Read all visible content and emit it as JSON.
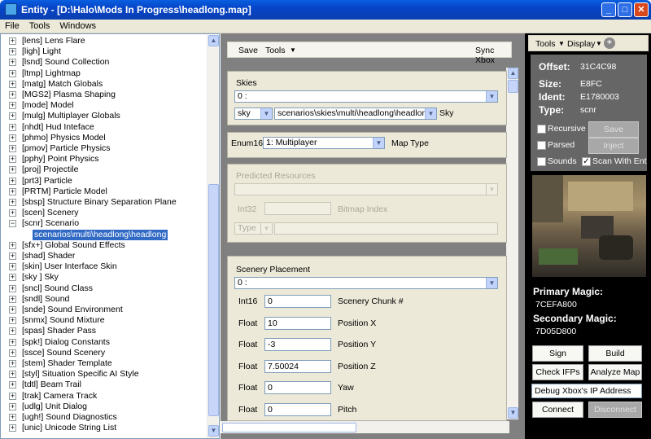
{
  "window": {
    "title": "Entity - [D:\\Halo\\Mods In Progress\\headlong.map]",
    "min": "_",
    "max": "□",
    "close": "✕"
  },
  "menu": [
    "File",
    "Tools",
    "Windows"
  ],
  "tree": [
    "[lens] Lens Flare",
    "[ligh] Light",
    "[lsnd] Sound Collection",
    "[ltmp] Lightmap",
    "[matg] Match Globals",
    "[MGS2] Plasma Shaping",
    "[mode] Model",
    "[mulg] Multiplayer Globals",
    "[nhdt] Hud Inteface",
    "[phmo] Physics Model",
    "[pmov] Particle Physics",
    "[pphy] Point Physics",
    "[proj] Projectile",
    "[prt3] Particle",
    "[PRTM] Particle Model",
    "[sbsp] Structure Binary Separation Plane",
    "[scen] Scenery",
    "[scnr] Scenario",
    "[sfx+] Global Sound Effects",
    "[shad] Shader",
    "[skin] User Interface Skin",
    "[sky ] Sky",
    "[sncl] Sound Class",
    "[sndl] Sound",
    "[snde] Sound Environment",
    "[snmx] Sound Mixture",
    "[spas] Shader Pass",
    "[spk!] Dialog Constants",
    "[ssce] Sound Scenery",
    "[stem] Shader Template",
    "[styl] Situation Specific AI Style",
    "[tdtl] Beam Trail",
    "[trak] Camera Track",
    "[udlg] Unit Dialog",
    "[ugh!] Sound Diagnostics",
    "[unic] Unicode String List"
  ],
  "tree_child": "scenarios\\multi\\headlong\\headlong",
  "center_toolbar": {
    "save": "Save",
    "tools": "Tools",
    "sync": "Sync Xbox"
  },
  "skies": {
    "title": "Skies",
    "index": "0 :",
    "type": "sky",
    "path": "scenarios\\skies\\multi\\headlong\\headlong",
    "label": "Sky"
  },
  "enum": {
    "type": "Enum16",
    "value": "1: Multiplayer",
    "label": "Map Type"
  },
  "predicted": {
    "title": "Predicted Resources",
    "type": "Int32",
    "label": "Bitmap Index",
    "combo": "Type"
  },
  "scenery": {
    "title": "Scenery Placement",
    "index": "0 :",
    "fields": [
      {
        "type": "Int16",
        "value": "0",
        "label": "Scenery Chunk #"
      },
      {
        "type": "Float",
        "value": "10",
        "label": "Position X"
      },
      {
        "type": "Float",
        "value": "-3",
        "label": "Position Y"
      },
      {
        "type": "Float",
        "value": "7.50024",
        "label": "Position Z"
      },
      {
        "type": "Float",
        "value": "0",
        "label": "Yaw"
      },
      {
        "type": "Float",
        "value": "0",
        "label": "Pitch"
      }
    ]
  },
  "right_toolbar": {
    "tools": "Tools",
    "display": "Display"
  },
  "info": {
    "offset_l": "Offset:",
    "offset": "31C4C98",
    "size_l": "Size:",
    "size": "E8FC",
    "ident_l": "Ident:",
    "ident": "E1780003",
    "type_l": "Type:",
    "type": "scnr"
  },
  "options": {
    "recursive": "Recursive",
    "parsed": "Parsed",
    "sounds": "Sounds",
    "scan": "Scan With Ent",
    "save": "Save",
    "inject": "Inject"
  },
  "magic": {
    "primary_l": "Primary Magic:",
    "primary": "7CEFA800",
    "secondary_l": "Secondary Magic:",
    "secondary": "7D05D800"
  },
  "actions": {
    "sign": "Sign",
    "build": "Build",
    "check": "Check IFPs",
    "analyze": "Analyze Map",
    "ip": "Debug  Xbox's  IP  Address",
    "connect": "Connect",
    "disconnect": "Disconnect"
  }
}
